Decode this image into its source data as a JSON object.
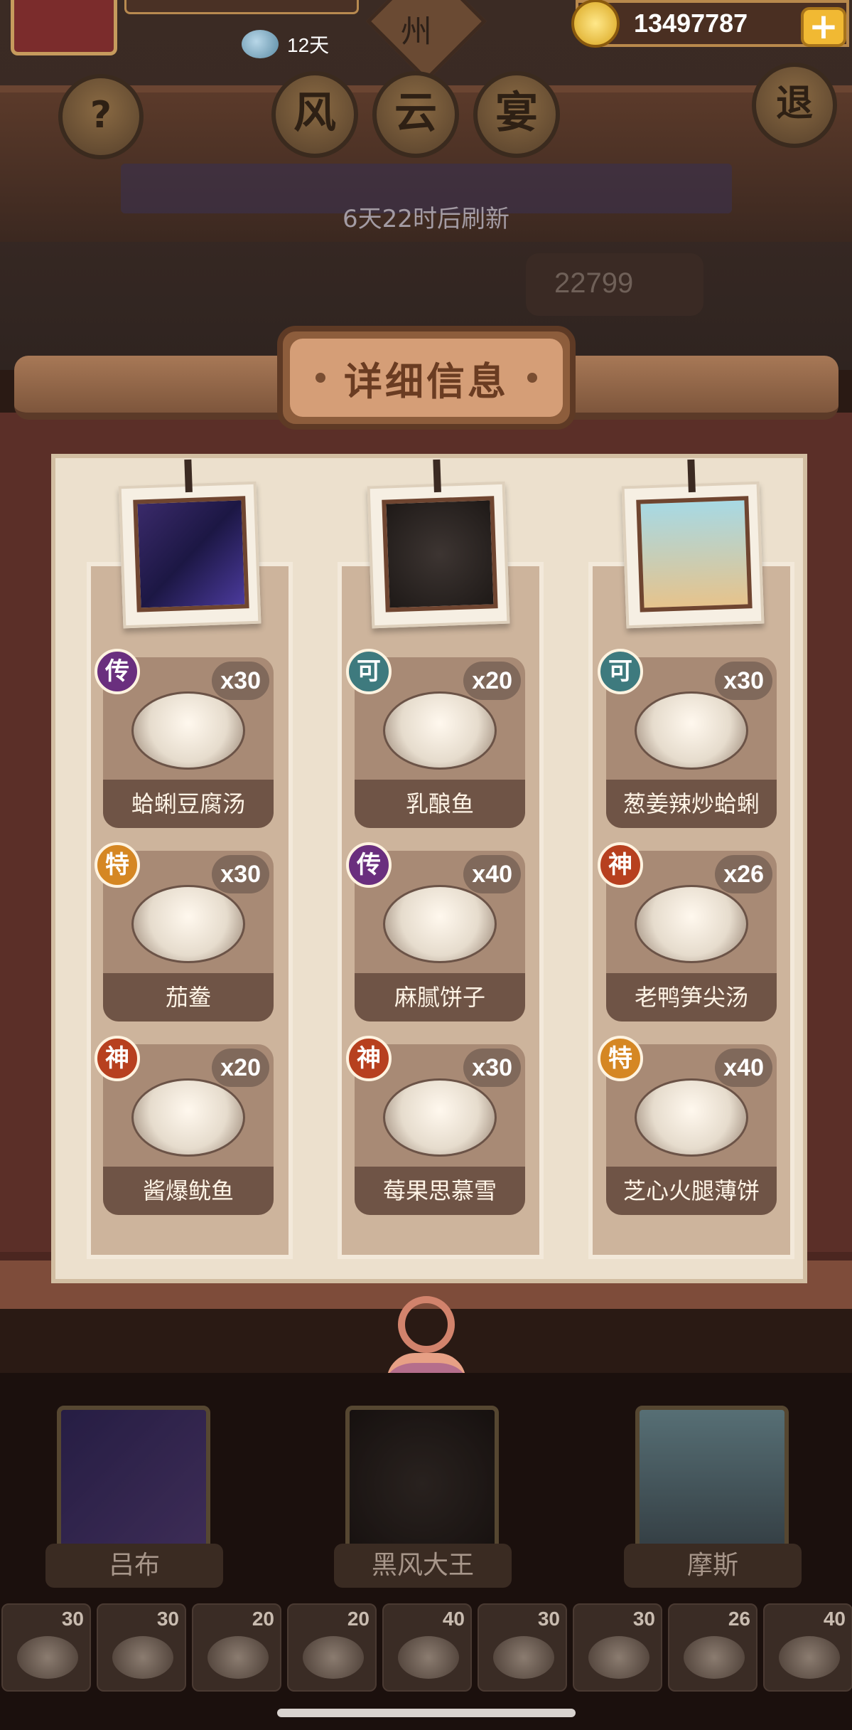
{
  "header": {
    "days_remaining": "12天",
    "region_char": "州",
    "coins": "13497787",
    "plus_label": "+",
    "help_label": "?",
    "exit_label": "退",
    "feast_title": [
      "风",
      "云",
      "宴"
    ],
    "refresh_text": "6天22时后刷新",
    "score_partial": "22799"
  },
  "panel": {
    "title": "详细信息"
  },
  "chefs": [
    {
      "name": "吕布",
      "dishes": [
        {
          "tier": "传",
          "tier_class": "tier-chuan",
          "qty": "x30",
          "name": "蛤蜊豆腐汤"
        },
        {
          "tier": "特",
          "tier_class": "tier-te",
          "qty": "x30",
          "name": "茄鲞"
        },
        {
          "tier": "神",
          "tier_class": "tier-shen",
          "qty": "x20",
          "name": "酱爆鱿鱼"
        }
      ]
    },
    {
      "name": "黑风大王",
      "dishes": [
        {
          "tier": "可",
          "tier_class": "tier-ke",
          "qty": "x20",
          "name": "乳酿鱼"
        },
        {
          "tier": "传",
          "tier_class": "tier-chuan",
          "qty": "x40",
          "name": "麻腻饼子"
        },
        {
          "tier": "神",
          "tier_class": "tier-shen",
          "qty": "x30",
          "name": "莓果思慕雪"
        }
      ]
    },
    {
      "name": "摩斯",
      "dishes": [
        {
          "tier": "可",
          "tier_class": "tier-ke",
          "qty": "x30",
          "name": "葱姜辣炒蛤蜊"
        },
        {
          "tier": "神",
          "tier_class": "tier-shen",
          "qty": "x26",
          "name": "老鸭笋尖汤"
        },
        {
          "tier": "特",
          "tier_class": "tier-te",
          "qty": "x40",
          "name": "芝心火腿薄饼"
        }
      ]
    }
  ],
  "bottom_strip": [
    "30",
    "30",
    "20",
    "20",
    "40",
    "30",
    "30",
    "26",
    "40"
  ]
}
